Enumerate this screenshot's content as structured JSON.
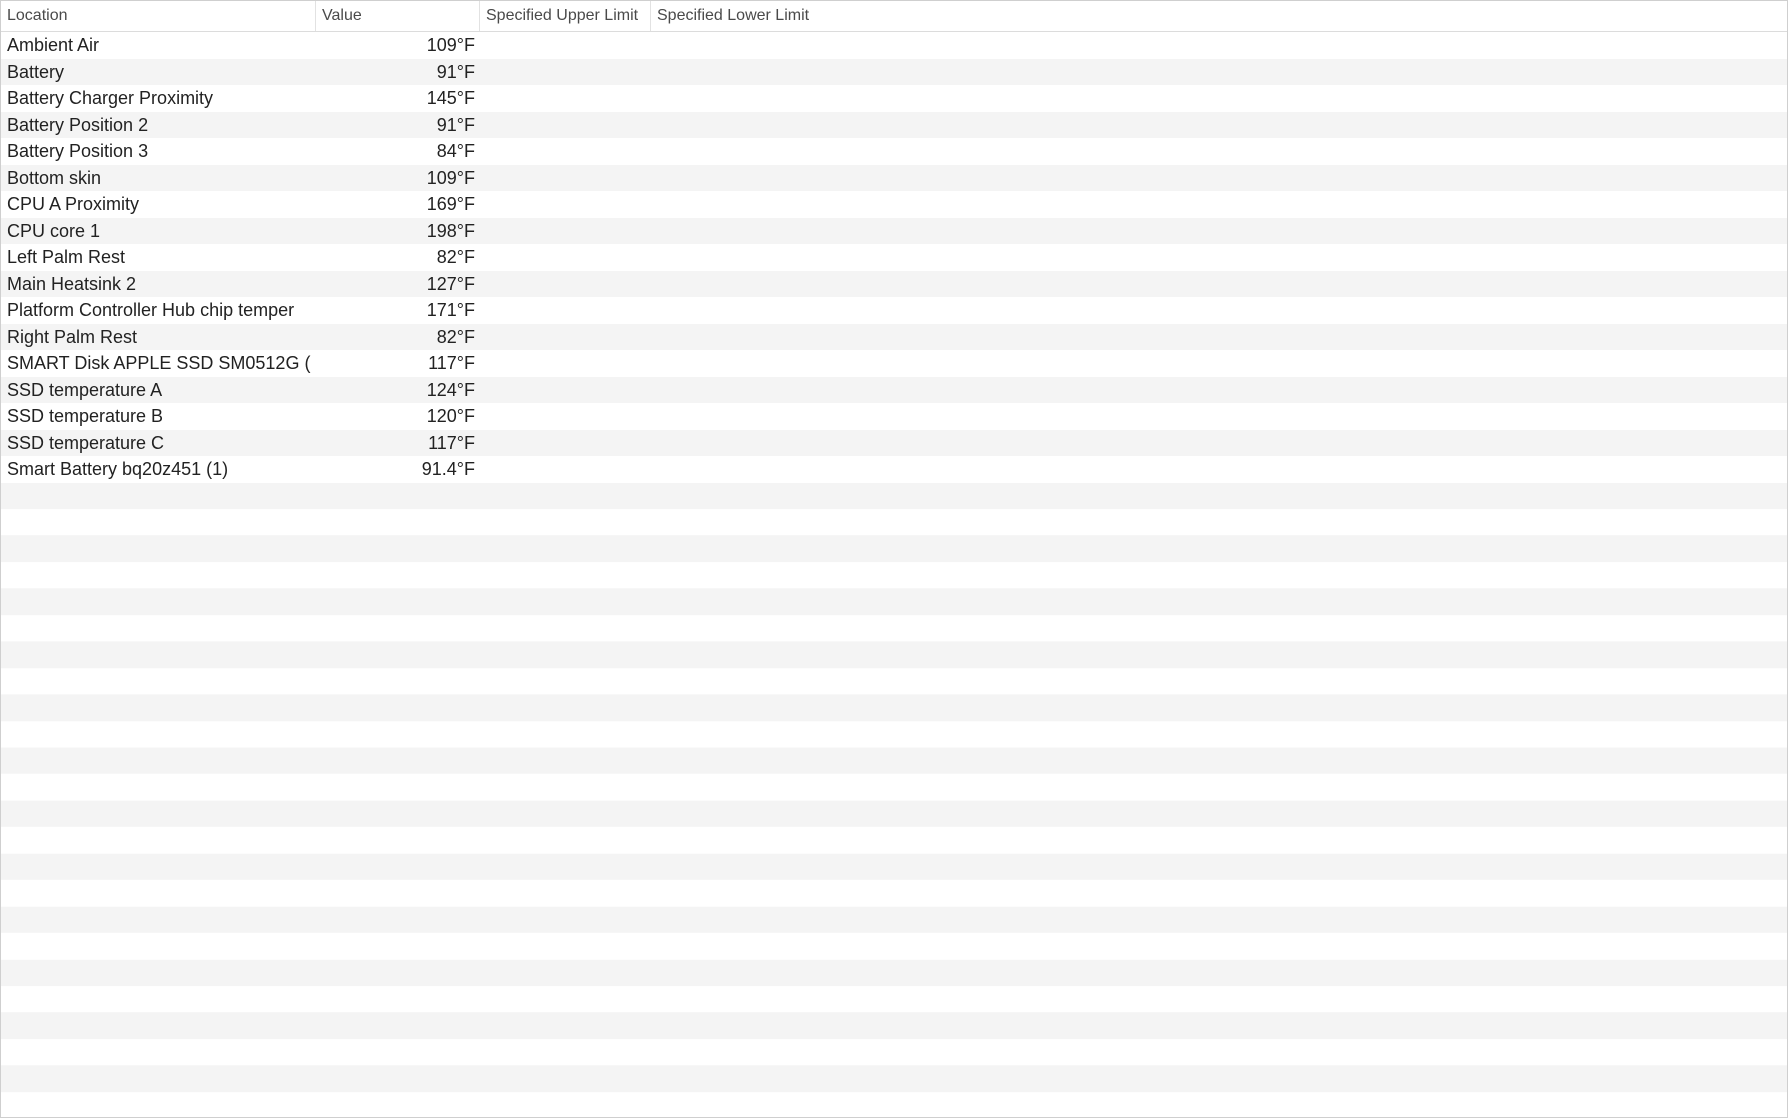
{
  "table": {
    "columns": {
      "location": "Location",
      "value": "Value",
      "upper_limit": "Specified Upper Limit",
      "lower_limit": "Specified Lower Limit"
    },
    "rows": [
      {
        "location": "Ambient Air",
        "value": "109°F",
        "upper": "",
        "lower": ""
      },
      {
        "location": "Battery",
        "value": "91°F",
        "upper": "",
        "lower": ""
      },
      {
        "location": "Battery Charger Proximity",
        "value": "145°F",
        "upper": "",
        "lower": ""
      },
      {
        "location": "Battery Position 2",
        "value": "91°F",
        "upper": "",
        "lower": ""
      },
      {
        "location": "Battery Position 3",
        "value": "84°F",
        "upper": "",
        "lower": ""
      },
      {
        "location": "Bottom skin",
        "value": "109°F",
        "upper": "",
        "lower": ""
      },
      {
        "location": "CPU A Proximity",
        "value": "169°F",
        "upper": "",
        "lower": ""
      },
      {
        "location": "CPU core 1",
        "value": "198°F",
        "upper": "",
        "lower": ""
      },
      {
        "location": "Left Palm Rest",
        "value": "82°F",
        "upper": "",
        "lower": ""
      },
      {
        "location": "Main Heatsink 2",
        "value": "127°F",
        "upper": "",
        "lower": ""
      },
      {
        "location": "Platform Controller Hub chip temper",
        "value": "171°F",
        "upper": "",
        "lower": ""
      },
      {
        "location": "Right Palm Rest",
        "value": "82°F",
        "upper": "",
        "lower": ""
      },
      {
        "location": "SMART Disk APPLE SSD SM0512G (",
        "value": "117°F",
        "upper": "",
        "lower": ""
      },
      {
        "location": "SSD temperature A",
        "value": "124°F",
        "upper": "",
        "lower": ""
      },
      {
        "location": "SSD temperature B",
        "value": "120°F",
        "upper": "",
        "lower": ""
      },
      {
        "location": "SSD temperature C",
        "value": "117°F",
        "upper": "",
        "lower": ""
      },
      {
        "location": "Smart Battery bq20z451 (1)",
        "value": "91.4°F",
        "upper": "",
        "lower": ""
      }
    ]
  }
}
